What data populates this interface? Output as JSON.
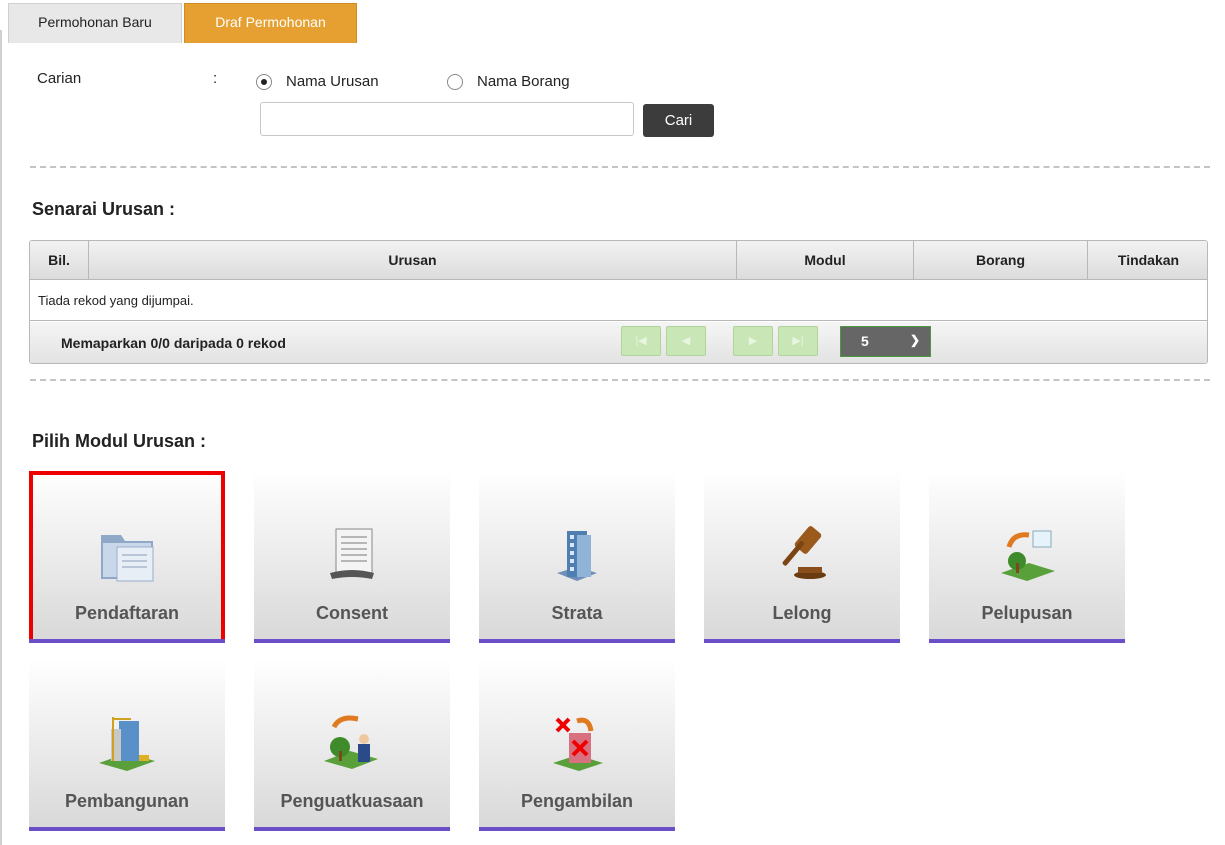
{
  "tabs": [
    {
      "label": "Permohonan Baru",
      "active": false
    },
    {
      "label": "Draf Permohonan",
      "active": true
    }
  ],
  "search": {
    "label": "Carian",
    "colon": ":",
    "options": [
      {
        "label": "Nama Urusan",
        "selected": true
      },
      {
        "label": "Nama Borang",
        "selected": false
      }
    ],
    "input_value": "",
    "button_label": "Cari"
  },
  "list_section": {
    "title": "Senarai Urusan :",
    "columns": [
      "Bil.",
      "Urusan",
      "Modul",
      "Borang",
      "Tindakan"
    ],
    "empty_message": "Tiada rekod yang dijumpai.",
    "page_info": "Memaparkan 0/0 daripada 0 rekod",
    "rows_per_page": "5"
  },
  "modules_section": {
    "title": "Pilih Modul Urusan :",
    "modules": [
      {
        "label": "Pendaftaran",
        "icon": "folder-icon",
        "selected": true
      },
      {
        "label": "Consent",
        "icon": "document-icon",
        "selected": false
      },
      {
        "label": "Strata",
        "icon": "building-icon",
        "selected": false
      },
      {
        "label": "Lelong",
        "icon": "gavel-icon",
        "selected": false
      },
      {
        "label": "Pelupusan",
        "icon": "land-disposal-icon",
        "selected": false
      },
      {
        "label": "Pembangunan",
        "icon": "construction-icon",
        "selected": false
      },
      {
        "label": "Penguatkuasaan",
        "icon": "enforcement-icon",
        "selected": false
      },
      {
        "label": "Pengambilan",
        "icon": "acquisition-icon",
        "selected": false
      }
    ]
  },
  "colors": {
    "active_tab": "#e6a032",
    "tile_underline": "#6b4fc9",
    "selection_outline": "#ee0000",
    "paginator_button": "#c9e6b6"
  }
}
